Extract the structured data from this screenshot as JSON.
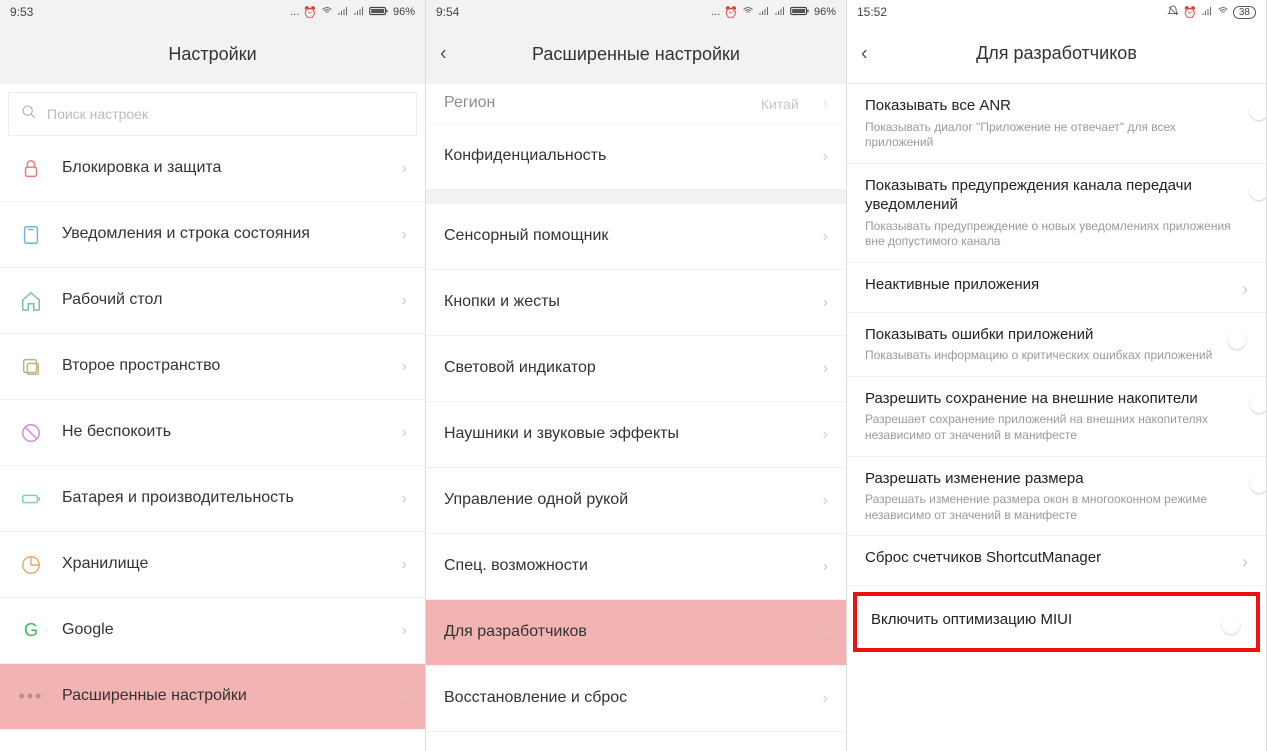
{
  "screen1": {
    "time": "9:53",
    "battery": "96%",
    "title": "Настройки",
    "search_placeholder": "Поиск настроек",
    "items": [
      {
        "name": "lock-protect",
        "label": "Блокировка и защита",
        "icon": "lock",
        "color": "#e87b7b"
      },
      {
        "name": "notifications",
        "label": "Уведомления и строка состояния",
        "icon": "notif",
        "color": "#6fb5e8"
      },
      {
        "name": "desktop",
        "label": "Рабочий стол",
        "icon": "home",
        "color": "#7bc09b"
      },
      {
        "name": "second-space",
        "label": "Второе пространство",
        "icon": "square",
        "color": "#c0b27b"
      },
      {
        "name": "dnd",
        "label": "Не беспокоить",
        "icon": "circle-slash",
        "color": "#d08bd6"
      },
      {
        "name": "battery-perf",
        "label": "Батарея и производительность",
        "icon": "battery",
        "color": "#7bd0c7"
      },
      {
        "name": "storage",
        "label": "Хранилище",
        "icon": "pie",
        "color": "#e8a96f"
      },
      {
        "name": "google",
        "label": "Google",
        "icon": "g",
        "color": "#3cba54"
      },
      {
        "name": "advanced",
        "label": "Расширенные настройки",
        "icon": "dots",
        "color": "#b88b8b",
        "hl": true
      }
    ]
  },
  "screen2": {
    "time": "9:54",
    "battery": "96%",
    "title": "Расширенные настройки",
    "top_item": {
      "label": "Регион",
      "value": "Китай"
    },
    "items": [
      {
        "name": "privacy",
        "label": "Конфиденциальность"
      },
      {
        "name": "sensor-assistant",
        "label": "Сенсорный помощник",
        "gap_before": true
      },
      {
        "name": "buttons-gestures",
        "label": "Кнопки и жесты"
      },
      {
        "name": "led",
        "label": "Световой индикатор"
      },
      {
        "name": "headphones",
        "label": "Наушники и звуковые эффекты"
      },
      {
        "name": "onehanded",
        "label": "Управление одной рукой"
      },
      {
        "name": "accessibility",
        "label": "Спец. возможности"
      },
      {
        "name": "developers",
        "label": "Для разработчиков",
        "hl": true
      },
      {
        "name": "backup-reset",
        "label": "Восстановление и сброс"
      }
    ]
  },
  "screen3": {
    "time": "15:52",
    "battery": "38",
    "title": "Для разработчиков",
    "items": [
      {
        "name": "show-anr",
        "title": "Показывать все ANR",
        "sub": "Показывать диалог \"Приложение не отвечает\" для всех приложений",
        "toggle": false
      },
      {
        "name": "channel-warnings",
        "title": "Показывать предупреждения канала передачи уведомлений",
        "sub": "Показывать предупреждение о новых уведомлениях приложения вне допустимого канала",
        "toggle": false
      },
      {
        "name": "inactive-apps",
        "title": "Неактивные приложения",
        "nav": true
      },
      {
        "name": "show-app-errors",
        "title": "Показывать ошибки приложений",
        "sub": "Показывать информацию о критических ошибках приложений",
        "toggle": true
      },
      {
        "name": "external-storage",
        "title": "Разрешить сохранение на внешние накопители",
        "sub": "Разрешает сохранение приложений на внешних накопителях независимо от значений в манифесте",
        "toggle": false
      },
      {
        "name": "resize",
        "title": "Разрешать изменение размера",
        "sub": "Разрешать изменение размера окон в многооконном режиме независимо от значений в манифесте",
        "toggle": false
      },
      {
        "name": "shortcut-reset",
        "title": "Сброс счетчиков ShortcutManager",
        "nav": true
      },
      {
        "name": "miui-opt",
        "title": "Включить оптимизацию MIUI",
        "toggle": true,
        "miui": true
      }
    ]
  }
}
